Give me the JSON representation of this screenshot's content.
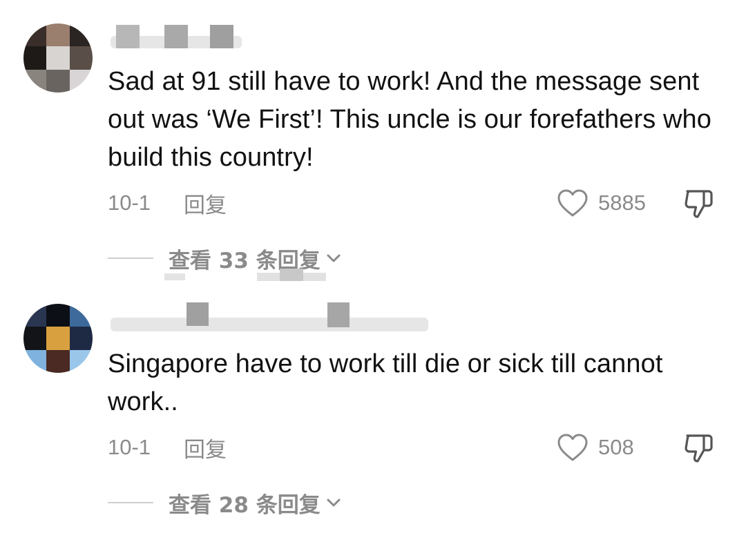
{
  "colors": {
    "text_primary": "#111111",
    "text_secondary": "#8a8a8a",
    "divider": "#cfcfcf",
    "background": "#ffffff"
  },
  "comments": [
    {
      "text": "Sad at 91 still have to work! And the message sent out was ‘We First’! This uncle is our forefathers who build this country!",
      "date": "10-1",
      "reply_label": "回复",
      "likes": "5885",
      "view_replies_label": "查看 33 条回复",
      "avatar_icon": "pixelated-avatar-icon",
      "username_icon": "pixelated-username"
    },
    {
      "text": "Singapore have to work till die or sick till cannot work..",
      "date": "10-1",
      "reply_label": "回复",
      "likes": "508",
      "view_replies_label": "查看 28 条回复",
      "avatar_icon": "pixelated-avatar-icon",
      "username_icon": "pixelated-username"
    }
  ],
  "icons": {
    "like": "heart-outline-icon",
    "dislike": "thumbs-down-icon",
    "expand": "chevron-down-icon"
  }
}
